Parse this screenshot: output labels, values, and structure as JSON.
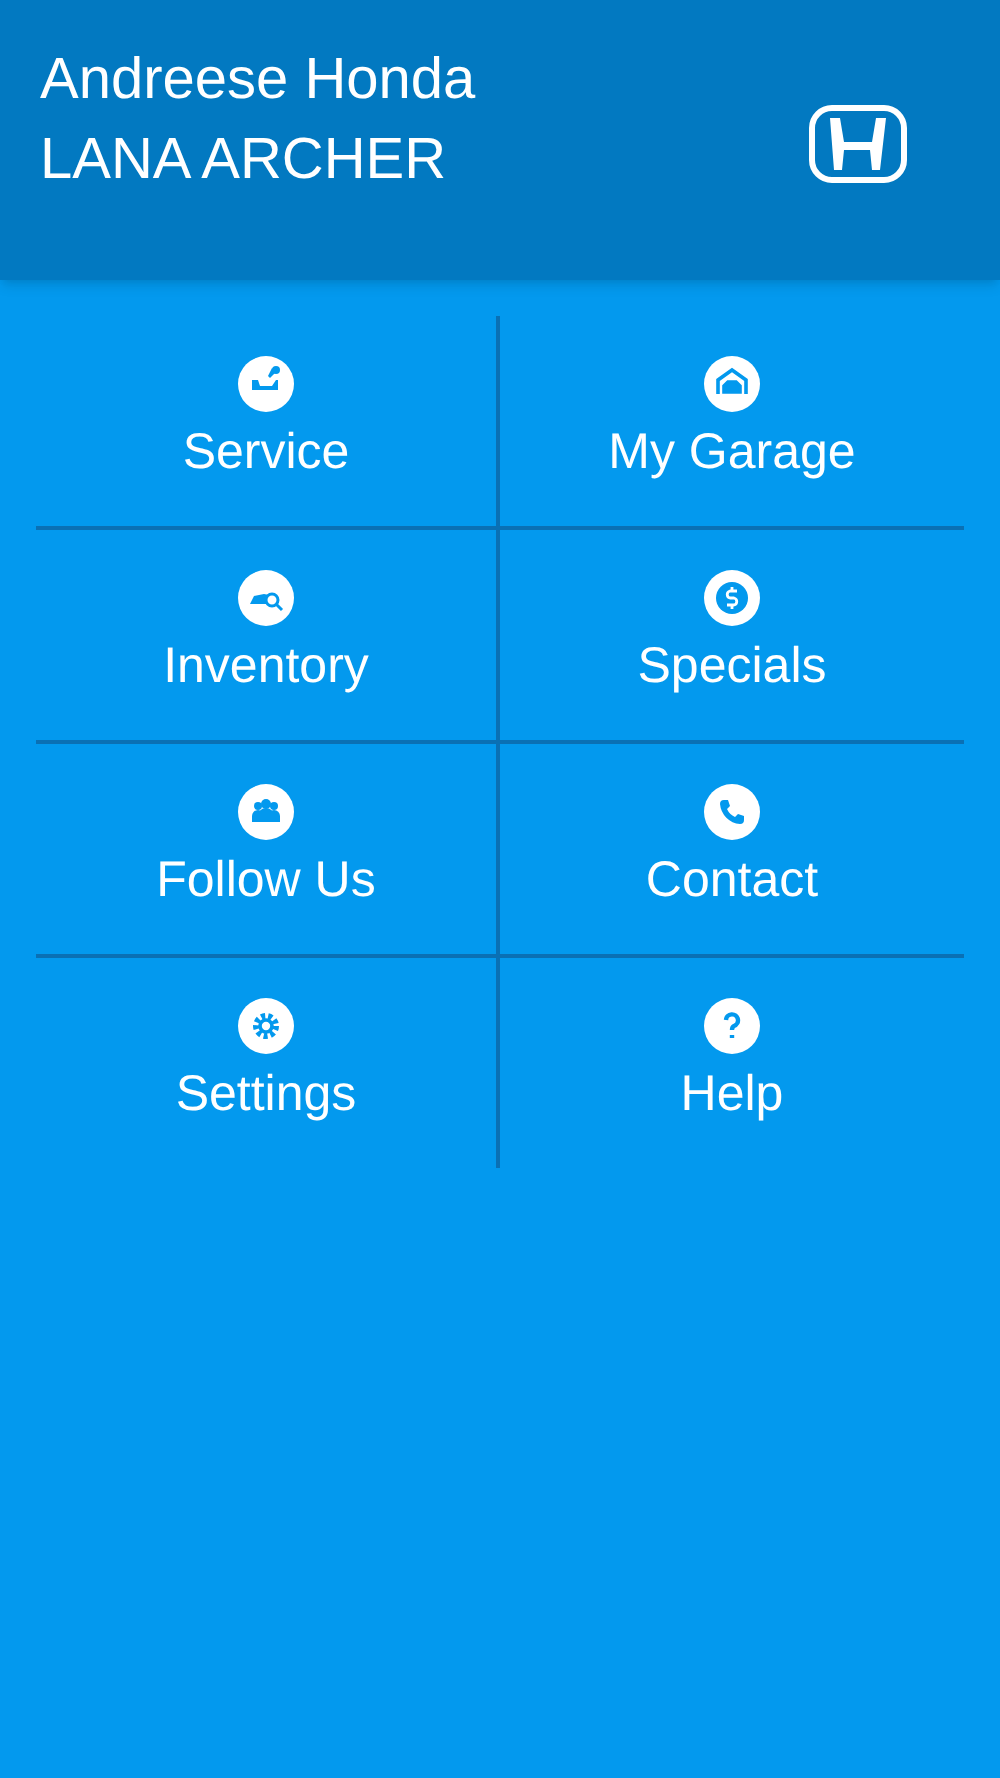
{
  "header": {
    "dealer": "Andreese Honda",
    "user": "LANA ARCHER"
  },
  "menu": [
    {
      "kind": "service",
      "label": "Service"
    },
    {
      "kind": "garage",
      "label": "My Garage"
    },
    {
      "kind": "inventory",
      "label": "Inventory"
    },
    {
      "kind": "specials",
      "label": "Specials"
    },
    {
      "kind": "follow",
      "label": "Follow Us"
    },
    {
      "kind": "contact",
      "label": "Contact"
    },
    {
      "kind": "settings",
      "label": "Settings"
    },
    {
      "kind": "help",
      "label": "Help"
    }
  ]
}
